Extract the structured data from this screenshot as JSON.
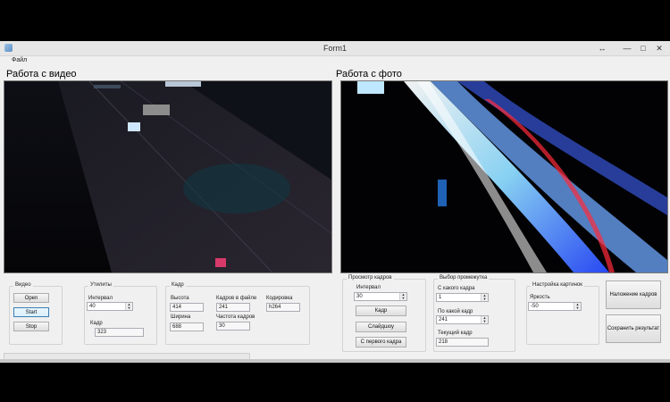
{
  "window": {
    "title": "Form1",
    "controls": {
      "restore": "↔",
      "minimize": "—",
      "maximize": "□",
      "close": "✕"
    }
  },
  "menu": {
    "file": "Файл"
  },
  "sections": {
    "video": "Работа с видео",
    "photo": "Работа с фото"
  },
  "video_group": {
    "title": "Видео",
    "open_label": "Open",
    "start_label": "Start",
    "stop_label": "Stop"
  },
  "utilities_group": {
    "title": "Утилиты",
    "interval_label": "Интервал",
    "interval_value": "40",
    "frame_label": "Кадр",
    "frame_value": "323"
  },
  "frame_group": {
    "title": "Кадр",
    "height_label": "Высота",
    "height_value": "414",
    "frames_in_file_label": "Кадров в файле",
    "frames_in_file_value": "241",
    "codec_label": "Кодировка",
    "codec_value": "h264",
    "width_label": "Ширина",
    "width_value": "688",
    "fps_label": "Частота кадров",
    "fps_value": "30"
  },
  "preview_group": {
    "title": "Просмотр кадров",
    "interval_label": "Интервал",
    "interval_value": "30",
    "frame_button": "Кадр",
    "slideshow_button": "Слайдшоу",
    "from_first_button": "С первого кадра"
  },
  "range_group": {
    "title": "Выбор промежутка",
    "from_label": "С какого кадра",
    "from_value": "1",
    "to_label": "По какой кадр",
    "to_value": "241",
    "current_label": "Текущий кадр",
    "current_value": "218"
  },
  "image_settings_group": {
    "title": "Настройка картинок",
    "brightness_label": "Яркость",
    "brightness_value": "-50"
  },
  "actions": {
    "overlay_button": "Наложение кадров",
    "save_button": "Сохранить результат"
  }
}
